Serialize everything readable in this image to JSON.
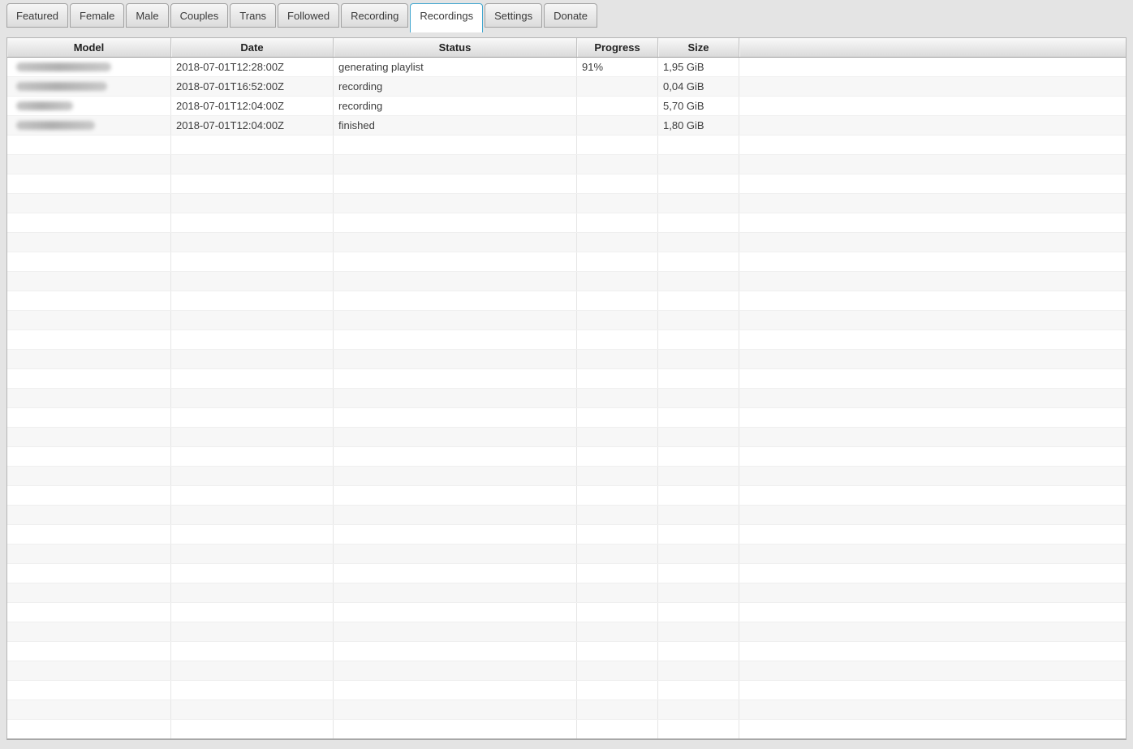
{
  "colors": {
    "page_background": "#e4e4e4",
    "active_tab_border": "#43a7cf",
    "row_stripe": "#f7f7f7"
  },
  "tabs": [
    {
      "label": "Featured",
      "active": false
    },
    {
      "label": "Female",
      "active": false
    },
    {
      "label": "Male",
      "active": false
    },
    {
      "label": "Couples",
      "active": false
    },
    {
      "label": "Trans",
      "active": false
    },
    {
      "label": "Followed",
      "active": false
    },
    {
      "label": "Recording",
      "active": false
    },
    {
      "label": "Recordings",
      "active": true
    },
    {
      "label": "Settings",
      "active": false
    },
    {
      "label": "Donate",
      "active": false
    }
  ],
  "table": {
    "columns": [
      "Model",
      "Date",
      "Status",
      "Progress",
      "Size",
      ""
    ],
    "rows": [
      {
        "model": {
          "redacted": true,
          "blur_width": 117
        },
        "date": "2018-07-01T12:28:00Z",
        "status": "generating playlist",
        "progress": "91%",
        "size": "1,95 GiB"
      },
      {
        "model": {
          "redacted": true,
          "blur_width": 112
        },
        "date": "2018-07-01T16:52:00Z",
        "status": "recording",
        "progress": "",
        "size": "0,04 GiB"
      },
      {
        "model": {
          "redacted": true,
          "blur_width": 70
        },
        "date": "2018-07-01T12:04:00Z",
        "status": "recording",
        "progress": "",
        "size": "5,70 GiB"
      },
      {
        "model": {
          "redacted": true,
          "blur_width": 97
        },
        "date": "2018-07-01T12:04:00Z",
        "status": "finished",
        "progress": "",
        "size": "1,80 GiB"
      }
    ],
    "empty_rows": 31
  }
}
